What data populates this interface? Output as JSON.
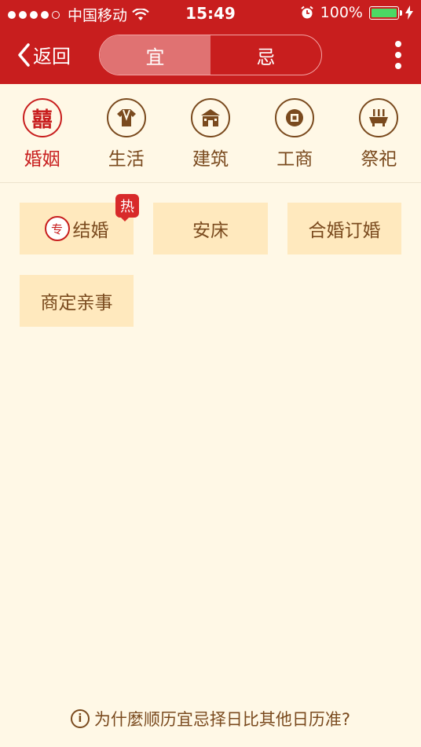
{
  "status_bar": {
    "carrier": "中国移动",
    "time": "15:49",
    "battery": "100%",
    "battery_level": 1.0,
    "signal_bars": 4
  },
  "nav": {
    "back_label": "返回",
    "segments": [
      {
        "label": "宜",
        "active": true
      },
      {
        "label": "忌",
        "active": false
      }
    ]
  },
  "categories": [
    {
      "label": "婚姻",
      "icon": "double-happiness-icon",
      "glyph": "囍",
      "active": true
    },
    {
      "label": "生活",
      "icon": "clothing-icon",
      "glyph": "",
      "active": false
    },
    {
      "label": "建筑",
      "icon": "house-icon",
      "glyph": "",
      "active": false
    },
    {
      "label": "工商",
      "icon": "coin-icon",
      "glyph": "",
      "active": false
    },
    {
      "label": "祭祀",
      "icon": "incense-burner-icon",
      "glyph": "",
      "active": false
    }
  ],
  "tags": [
    {
      "label": "结婚",
      "badge": "热",
      "icon_glyph": "专"
    },
    {
      "label": "安床"
    },
    {
      "label": "合婚订婚"
    },
    {
      "label": "商定亲事"
    }
  ],
  "footer": {
    "info_glyph": "i",
    "text": "为什麼顺历宜忌择日比其他日历准?"
  },
  "colors": {
    "header": "#C81E1E",
    "background": "#FFF8E6",
    "tag_background": "#FFE9BE",
    "brown": "#7A4A1E"
  }
}
